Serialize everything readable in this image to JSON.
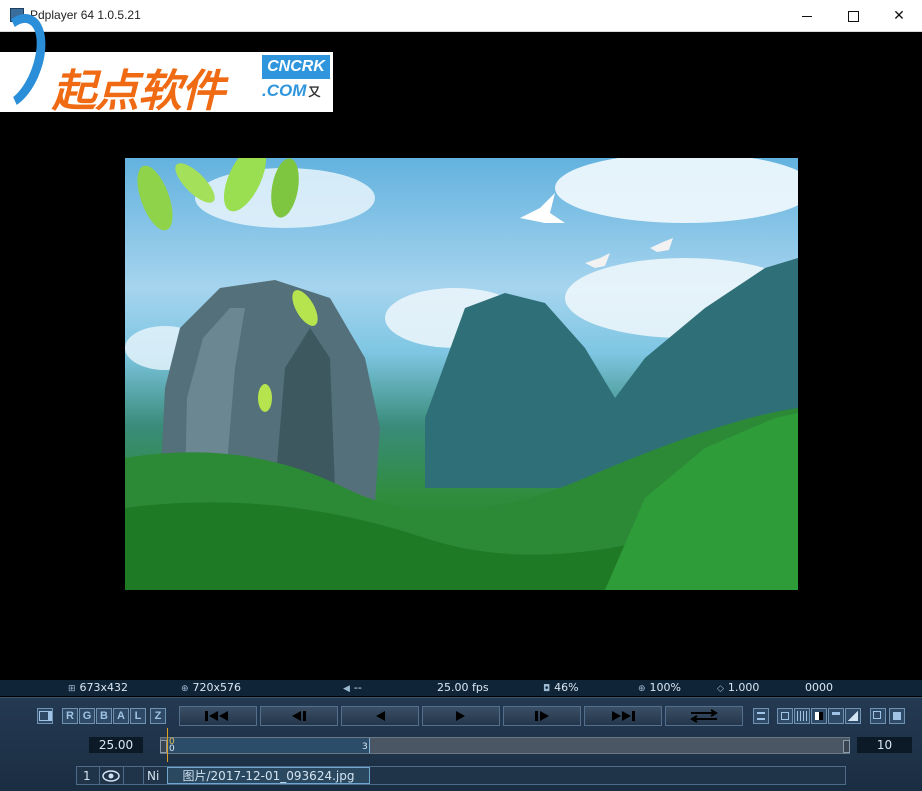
{
  "window": {
    "title": "Pdplayer 64 1.0.5.21",
    "minimize_glyph": "",
    "close_glyph": "✕"
  },
  "watermark": {
    "brand_cn": "起点软件",
    "brand_en": "CNCRK",
    "domain": ".COM",
    "mark": "又"
  },
  "status": {
    "frame_size": "673x432",
    "canvas_size": "720x576",
    "audio": "--",
    "fps": "25.00 fps",
    "opacity": "46%",
    "zoom": "100%",
    "gamma": "1.000",
    "timecode": "0000"
  },
  "channels": [
    "R",
    "G",
    "B",
    "A",
    "L",
    "Z"
  ],
  "transport": {
    "buttons": [
      "first-frame",
      "step-back",
      "play-backward",
      "play-forward",
      "step-forward",
      "last-frame",
      "loop"
    ]
  },
  "timeline": {
    "fps_value": "25.00",
    "start_top": "0",
    "start_bottom": "0",
    "current": "3",
    "end_value": "10",
    "progress": 0.3
  },
  "track": {
    "index": "1",
    "mode": "Ni",
    "filename": "图片/2017-12-01_093624.jpg"
  },
  "colors": {
    "panel": "#1a2d42",
    "status_bg": "#102438",
    "accent": "#6fa6cf"
  }
}
